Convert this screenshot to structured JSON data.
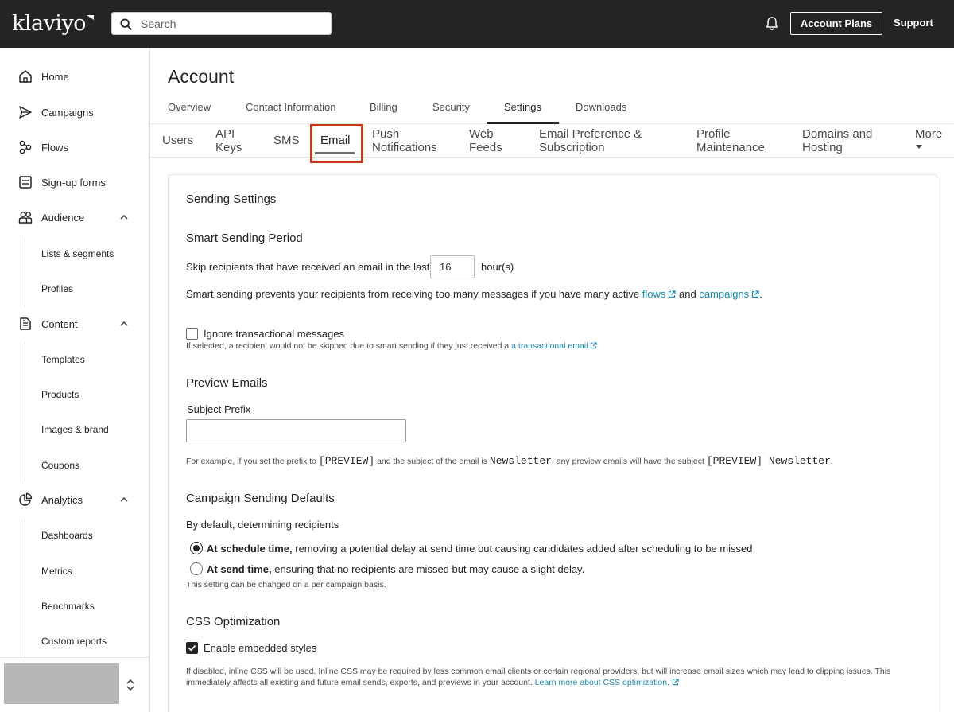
{
  "brand": {
    "logo_text": "klaviyo"
  },
  "topbar": {
    "search_placeholder": "Search",
    "account_plans_label": "Account Plans",
    "support_label": "Support"
  },
  "sidebar": {
    "items": [
      {
        "label": "Home",
        "icon": "home-icon"
      },
      {
        "label": "Campaigns",
        "icon": "send-icon"
      },
      {
        "label": "Flows",
        "icon": "flow-icon"
      },
      {
        "label": "Sign-up forms",
        "icon": "form-icon"
      },
      {
        "label": "Audience",
        "icon": "people-icon"
      },
      {
        "label": "Content",
        "icon": "content-icon"
      },
      {
        "label": "Analytics",
        "icon": "analytics-icon"
      }
    ],
    "audience_sub": [
      "Lists & segments",
      "Profiles"
    ],
    "content_sub": [
      "Templates",
      "Products",
      "Images & brand",
      "Coupons"
    ],
    "analytics_sub": [
      "Dashboards",
      "Metrics",
      "Benchmarks",
      "Custom reports"
    ]
  },
  "page": {
    "title": "Account",
    "tabs": [
      "Overview",
      "Contact Information",
      "Billing",
      "Security",
      "Settings",
      "Downloads"
    ],
    "active_tab": "Settings",
    "subtabs": [
      [
        "Users"
      ],
      [
        "API",
        "Keys"
      ],
      [
        "SMS"
      ],
      [
        "Email"
      ],
      [
        "Push",
        "Notifications"
      ],
      [
        "Web",
        "Feeds"
      ],
      [
        "Email Preference &",
        "Subscription"
      ],
      [
        "Profile",
        "Maintenance"
      ],
      [
        "Domains and",
        "Hosting"
      ],
      [
        "More"
      ]
    ],
    "active_subtab": "Email"
  },
  "settings": {
    "title": "Sending Settings",
    "smart_sending": {
      "heading": "Smart Sending Period",
      "skip_label": "Skip recipients that have received an email in the last",
      "hours_value": "16",
      "hours_unit": "hour(s)",
      "desc_before": "Smart sending prevents your recipients from receiving too many messages if you have many active",
      "link_flows": "flows",
      "desc_and": "and",
      "link_campaigns": "campaigns",
      "desc_end": ".",
      "ignore_label": "Ignore transactional messages",
      "ignore_checked": false,
      "ignore_help": "If selected, a recipient would not be skipped due to smart sending if they just received a",
      "ignore_link": "a transactional email"
    },
    "preview": {
      "heading": "Preview Emails",
      "prefix_label": "Subject Prefix",
      "prefix_value": "",
      "example_1": "For example, if you set the prefix to",
      "example_code_1": "[PREVIEW]",
      "example_2": "and the subject of the email is",
      "example_code_2": "Newsletter",
      "example_3": ", any preview emails will have the subject",
      "example_code_3": "[PREVIEW] Newsletter",
      "example_4": "."
    },
    "campaign_defaults": {
      "heading": "Campaign Sending Defaults",
      "sub_heading": "By default, determining recipients",
      "option1_bold": "At schedule time,",
      "option1_text": " removing a potential delay at send time but causing candidates added after scheduling to be missed",
      "option1_selected": true,
      "option2_bold": "At send time,",
      "option2_text": " ensuring that no recipients are missed but may cause a slight delay.",
      "option2_selected": false,
      "note": "This setting can be changed on a per campaign basis."
    },
    "css": {
      "heading": "CSS Optimization",
      "embedded_label": "Enable embedded styles",
      "embedded_checked": true,
      "help_line1": "If disabled, inline CSS will be used. Inline CSS may be required by less common email clients or certain regional providers, but will increase email sizes which may lead to clipping issues. This",
      "help_line2": "immediately affects all existing and future email sends, exports, and previews in your account.",
      "help_link": "Learn more about CSS optimization."
    }
  }
}
